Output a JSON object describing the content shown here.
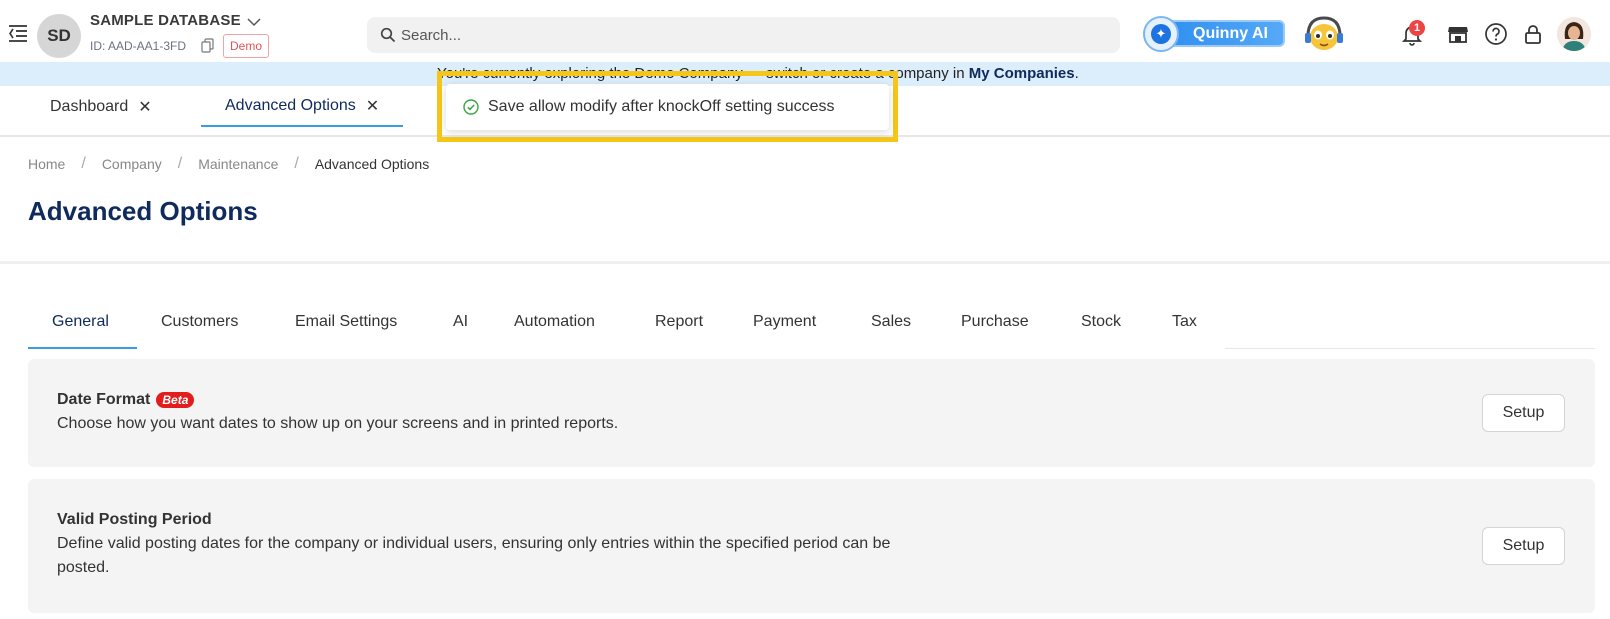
{
  "org": {
    "initials": "SD",
    "name": "SAMPLE DATABASE",
    "id_label": "ID: AAD-AA1-3FD",
    "badge": "Demo"
  },
  "search": {
    "placeholder": "Search..."
  },
  "quinny": {
    "label": "Quinny AI"
  },
  "notifications": {
    "count": "1"
  },
  "banner": {
    "text": "You're currently exploring the Demo Company — switch or create a company in ",
    "link": "My Companies",
    "suffix": "."
  },
  "page_tabs": [
    {
      "label": "Dashboard",
      "active": false
    },
    {
      "label": "Advanced Options",
      "active": true
    }
  ],
  "toast": {
    "message": "Save allow modify after knockOff setting success"
  },
  "breadcrumb": [
    "Home",
    "Company",
    "Maintenance",
    "Advanced Options"
  ],
  "page_title": "Advanced Options",
  "option_tabs": [
    "General",
    "Customers",
    "Email Settings",
    "AI",
    "Automation",
    "Report",
    "Payment",
    "Sales",
    "Purchase",
    "Stock",
    "Tax"
  ],
  "cards": [
    {
      "title": "Date Format",
      "badge": "Beta",
      "description": "Choose how you want dates to show up on your screens and in printed reports.",
      "button": "Setup"
    },
    {
      "title": "Valid Posting Period",
      "description_line1": "Define valid posting dates for the company or individual users, ensuring only entries within the specified period can be",
      "description_line2": "posted.",
      "button": "Setup"
    }
  ],
  "colors": {
    "brand_navy": "#0f2a5c",
    "accent_blue": "#3b9be0",
    "banner_bg": "#dcedfb",
    "highlight_yellow": "#f5c518",
    "beta_red": "#e11d1d"
  }
}
